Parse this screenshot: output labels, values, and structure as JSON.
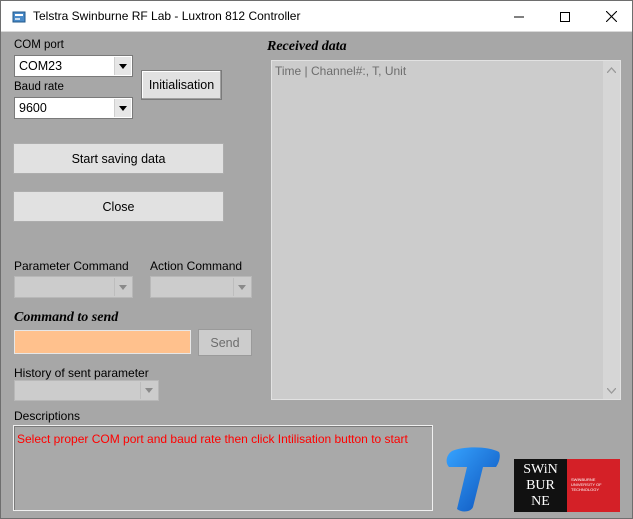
{
  "window": {
    "title": "Telstra Swinburne RF Lab - Luxtron 812 Controller"
  },
  "serial": {
    "com_port_label": "COM port",
    "com_port_value": "COM23",
    "baud_rate_label": "Baud rate",
    "baud_rate_value": "9600",
    "init_button": "Initialisation"
  },
  "buttons": {
    "start_saving": "Start saving data",
    "close": "Close",
    "send": "Send"
  },
  "commands": {
    "parameter_label": "Parameter Command",
    "action_label": "Action Command",
    "command_heading": "Command to send",
    "command_value": "",
    "history_label": "History of sent parameter"
  },
  "received": {
    "heading": "Received data",
    "header_line": "Time | Channel#:,  T,  Unit"
  },
  "descriptions": {
    "label": "Descriptions",
    "message": "Select proper COM port and baud rate then click Intilisation button to start"
  },
  "logos": {
    "telstra": "telstra-logo",
    "swinburne_lines": [
      "SWiN",
      "BUR",
      "NE"
    ],
    "swinburne_sub": "SWINBURNE UNIVERSITY OF TECHNOLOGY"
  },
  "colors": {
    "background": "#a7a7a7",
    "command_input": "#ffc18d",
    "message_text": "#ff0000",
    "telstra_blue": "#1a6ed8",
    "swinburne_red": "#d42027"
  }
}
